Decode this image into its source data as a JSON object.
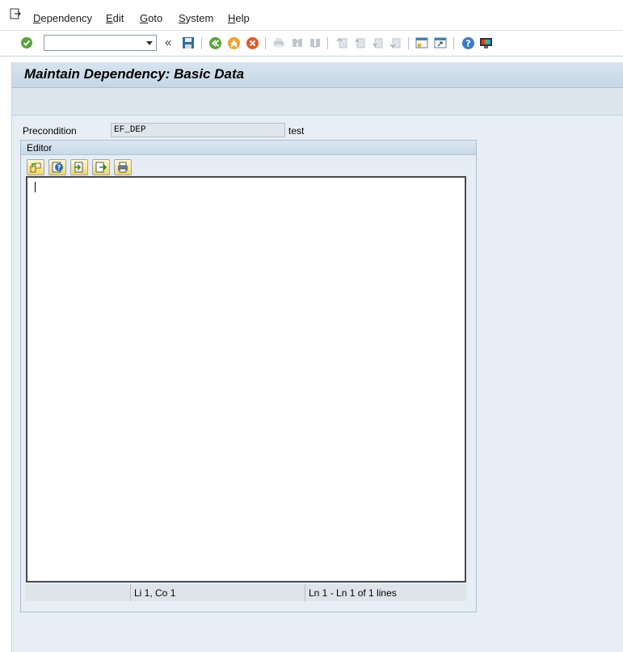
{
  "menubar": {
    "items": [
      "Dependency",
      "Edit",
      "Goto",
      "System",
      "Help"
    ]
  },
  "toolbar": {
    "command_field_value": "",
    "icons": [
      "enter-icon",
      "save-icon",
      "back-icon",
      "exit-icon",
      "cancel-icon",
      "print-icon",
      "find-icon",
      "find-next-icon",
      "first-page-icon",
      "previous-page-icon",
      "next-page-icon",
      "last-page-icon",
      "create-session-icon",
      "shortcut-icon",
      "help-icon",
      "customize-layout-icon"
    ]
  },
  "page": {
    "title": "Maintain Dependency: Basic Data"
  },
  "precondition": {
    "label": "Precondition",
    "value": "EF_DEP",
    "description": "test"
  },
  "editor": {
    "title": "Editor",
    "buttons": [
      "display-change-icon",
      "syntax-check-icon",
      "import-icon",
      "export-icon",
      "print-icon"
    ],
    "content": "",
    "status": {
      "cell1": "",
      "cursor": "Li 1, Co 1",
      "lines": "Ln 1 - Ln 1 of 1 lines"
    }
  },
  "colors": {
    "title_bar": "#c7d6e6",
    "page_bg": "#e8eef5",
    "button_bg": "#f1d66c"
  }
}
